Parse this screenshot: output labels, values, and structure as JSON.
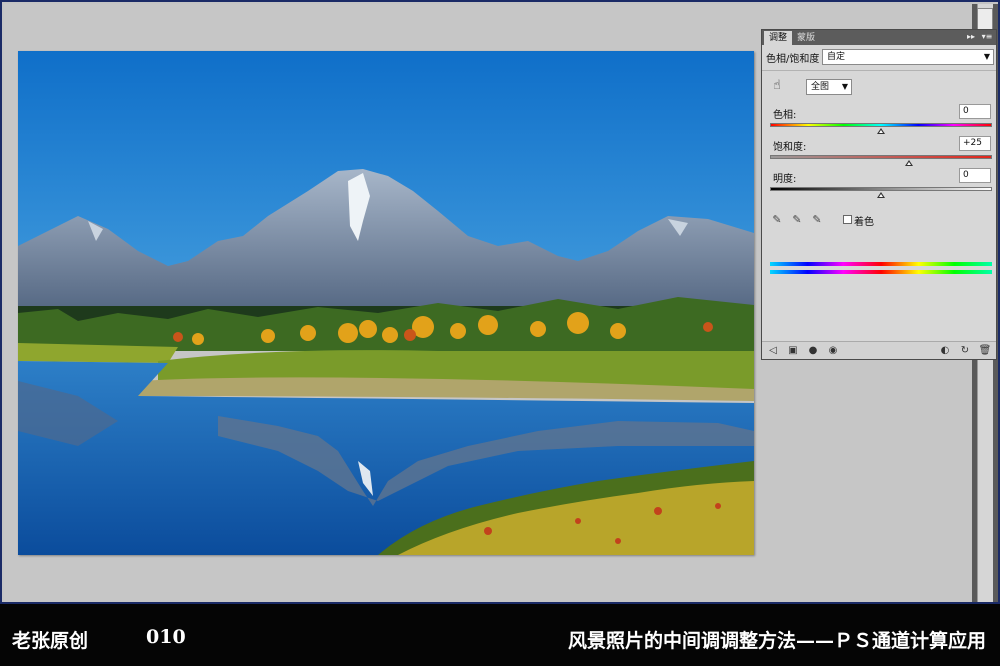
{
  "panel": {
    "tabs": [
      {
        "label": "调整"
      },
      {
        "label": "蒙版"
      }
    ],
    "preset_label": "色相/饱和度",
    "preset_value": "自定",
    "channel_value": "全图",
    "hue": {
      "label": "色相:",
      "value": "0"
    },
    "saturation": {
      "label": "饱和度:",
      "value": "+25"
    },
    "lightness": {
      "label": "明度:",
      "value": "0"
    },
    "colorize_label": "着色",
    "hue_level": 0.5,
    "saturation_level": 0.625,
    "lightness_level": 0.5
  },
  "caption": {
    "author": "老张原创",
    "number": "010",
    "title": "风景照片的中间调调整方法——ＰＳ通道计算应用"
  },
  "colors": {
    "workspace": "#c6c6c6",
    "panel": "#d7d7d7",
    "caption_bg": "#050505"
  }
}
